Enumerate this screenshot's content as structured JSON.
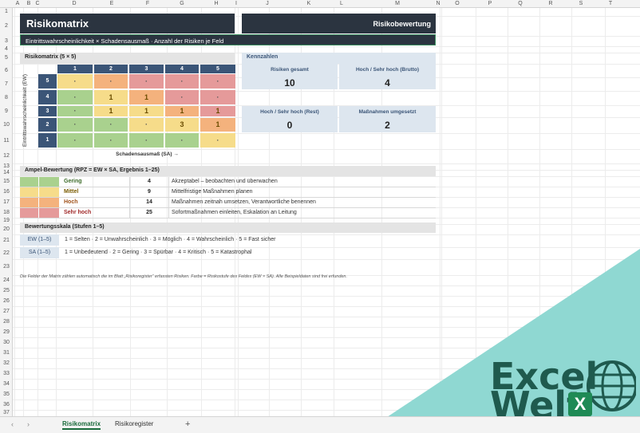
{
  "columns": [
    "A",
    "B",
    "C",
    "D",
    "E",
    "F",
    "G",
    "H",
    "I",
    "J",
    "K",
    "L",
    "M",
    "N",
    "O",
    "P",
    "Q",
    "R",
    "S",
    "T"
  ],
  "rows": [
    "1",
    "2",
    "3",
    "4",
    "5",
    "6",
    "7",
    "8",
    "9",
    "10",
    "11",
    "12",
    "13",
    "14",
    "15",
    "16",
    "17",
    "18",
    "19",
    "20",
    "21",
    "22",
    "23",
    "24",
    "25",
    "26",
    "27",
    "28",
    "29",
    "30",
    "31",
    "32",
    "33",
    "34",
    "35",
    "36",
    "37"
  ],
  "header": {
    "title": "Risikomatrix",
    "right_title": "Risikobewertung",
    "subtitle": "Eintrittswahrscheinlichkeit × Schadensausmaß · Anzahl der Risiken je Feld"
  },
  "matrix": {
    "section_title": "Risikomatrix (5 × 5)",
    "y_axis_label": "Eintrittswahrscheinlichkeit (EW)",
    "x_axis_label": "Schadensausmaß (SA) →",
    "col_headers": [
      "1",
      "2",
      "3",
      "4",
      "5"
    ],
    "rows": [
      {
        "ew": "5",
        "cells": [
          "·",
          "·",
          "·",
          "·",
          "·"
        ]
      },
      {
        "ew": "4",
        "cells": [
          "·",
          "1",
          "1",
          "·",
          "·"
        ]
      },
      {
        "ew": "3",
        "cells": [
          "·",
          "1",
          "1",
          "1",
          "1"
        ]
      },
      {
        "ew": "2",
        "cells": [
          "·",
          "·",
          "·",
          "3",
          "1"
        ]
      },
      {
        "ew": "1",
        "cells": [
          "·",
          "·",
          "·",
          "·",
          "·"
        ]
      }
    ],
    "colors": {
      "green": "#a9d18e",
      "yellow": "#f6dc8a",
      "orange": "#f4b27d",
      "red": "#e59a9a",
      "header_blue": "#3b5577"
    }
  },
  "kpis": {
    "section_title": "Kennzahlen",
    "items": [
      {
        "label": "Risiken gesamt",
        "value": "10"
      },
      {
        "label": "Hoch / Sehr hoch (Brutto)",
        "value": "4"
      },
      {
        "label": "Hoch / Sehr hoch (Rest)",
        "value": "0"
      },
      {
        "label": "Maßnahmen umgesetzt",
        "value": "2"
      }
    ]
  },
  "ampel": {
    "section_title": "Ampel-Bewertung (RPZ = EW × SA, Ergebnis 1–25)",
    "rows": [
      {
        "name": "Gering",
        "rpz": "4",
        "desc": "Akzeptabel – beobachten und überwachen",
        "color": "#a9d18e",
        "text_color": "#3d6b2a"
      },
      {
        "name": "Mittel",
        "rpz": "9",
        "desc": "Mittelfristige Maßnahmen planen",
        "color": "#f6dc8a",
        "text_color": "#7a5b00"
      },
      {
        "name": "Hoch",
        "rpz": "14",
        "desc": "Maßnahmen zeitnah umsetzen, Verantwortliche benennen",
        "color": "#f4b27d",
        "text_color": "#a0521a"
      },
      {
        "name": "Sehr hoch",
        "rpz": "25",
        "desc": "Sofortmaßnahmen einleiten, Eskalation an Leitung",
        "color": "#e59a9a",
        "text_color": "#a02828"
      }
    ]
  },
  "scale": {
    "section_title": "Bewertungsskala (Stufen 1–5)",
    "rows": [
      {
        "key": "EW (1–5)",
        "values": "1 = Selten   ·   2 = Unwahrscheinlich   ·   3 = Möglich   ·   4 = Wahrscheinlich   ·   5 = Fast sicher"
      },
      {
        "key": "SA (1–5)",
        "values": "1 = Unbedeutend   ·   2 = Gering   ·   3 = Spürbar   ·   4 = Kritisch   ·   5 = Katastrophal"
      }
    ]
  },
  "note": "Die Felder der Matrix zählen automatisch die im Blatt „Risikoregister“ erfassten Risiken. Farbe = Risikostufe des Feldes (EW × SA). Alle Beispieldaten sind frei erfunden.",
  "tabs": [
    {
      "label": "Risikomatrix",
      "active": true
    },
    {
      "label": "Risikoregister",
      "active": false
    }
  ],
  "add_tab": "+",
  "nav": {
    "prev": "‹",
    "next": "›"
  },
  "watermark": {
    "line1": "Excel",
    "line2": "Welt",
    "badge": "X"
  }
}
